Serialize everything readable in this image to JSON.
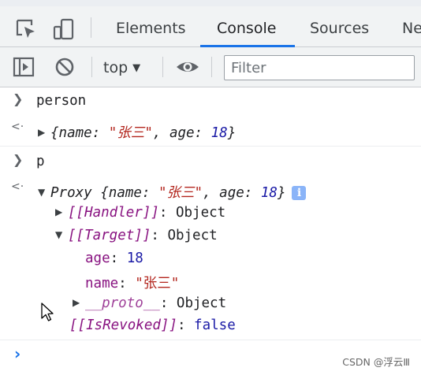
{
  "tabs": [
    "Elements",
    "Console",
    "Sources",
    "Ne"
  ],
  "toolbar": {
    "context": "top",
    "filter_placeholder": "Filter"
  },
  "console": {
    "entry1_input": "person",
    "entry1_output": {
      "open": "{",
      "k1": "name",
      "v1": "\"张三\"",
      "k2": "age",
      "v2": "18",
      "close": "}"
    },
    "entry2_input": "p",
    "entry2_output": {
      "label": "Proxy",
      "open": "{",
      "k1": "name",
      "v1": "\"张三\"",
      "k2": "age",
      "v2": "18",
      "close": "}"
    },
    "handler": {
      "key": "[[Handler]]",
      "value": "Object"
    },
    "target": {
      "key": "[[Target]]",
      "value": "Object"
    },
    "target_age": {
      "key": "age",
      "value": "18"
    },
    "target_name": {
      "key": "name",
      "value": "\"张三\""
    },
    "proto": {
      "key": "__proto__",
      "value": "Object"
    },
    "revoked": {
      "key": "[[IsRevoked]]",
      "value": "false"
    }
  },
  "watermark": "CSDN @浮云Ⅲ"
}
